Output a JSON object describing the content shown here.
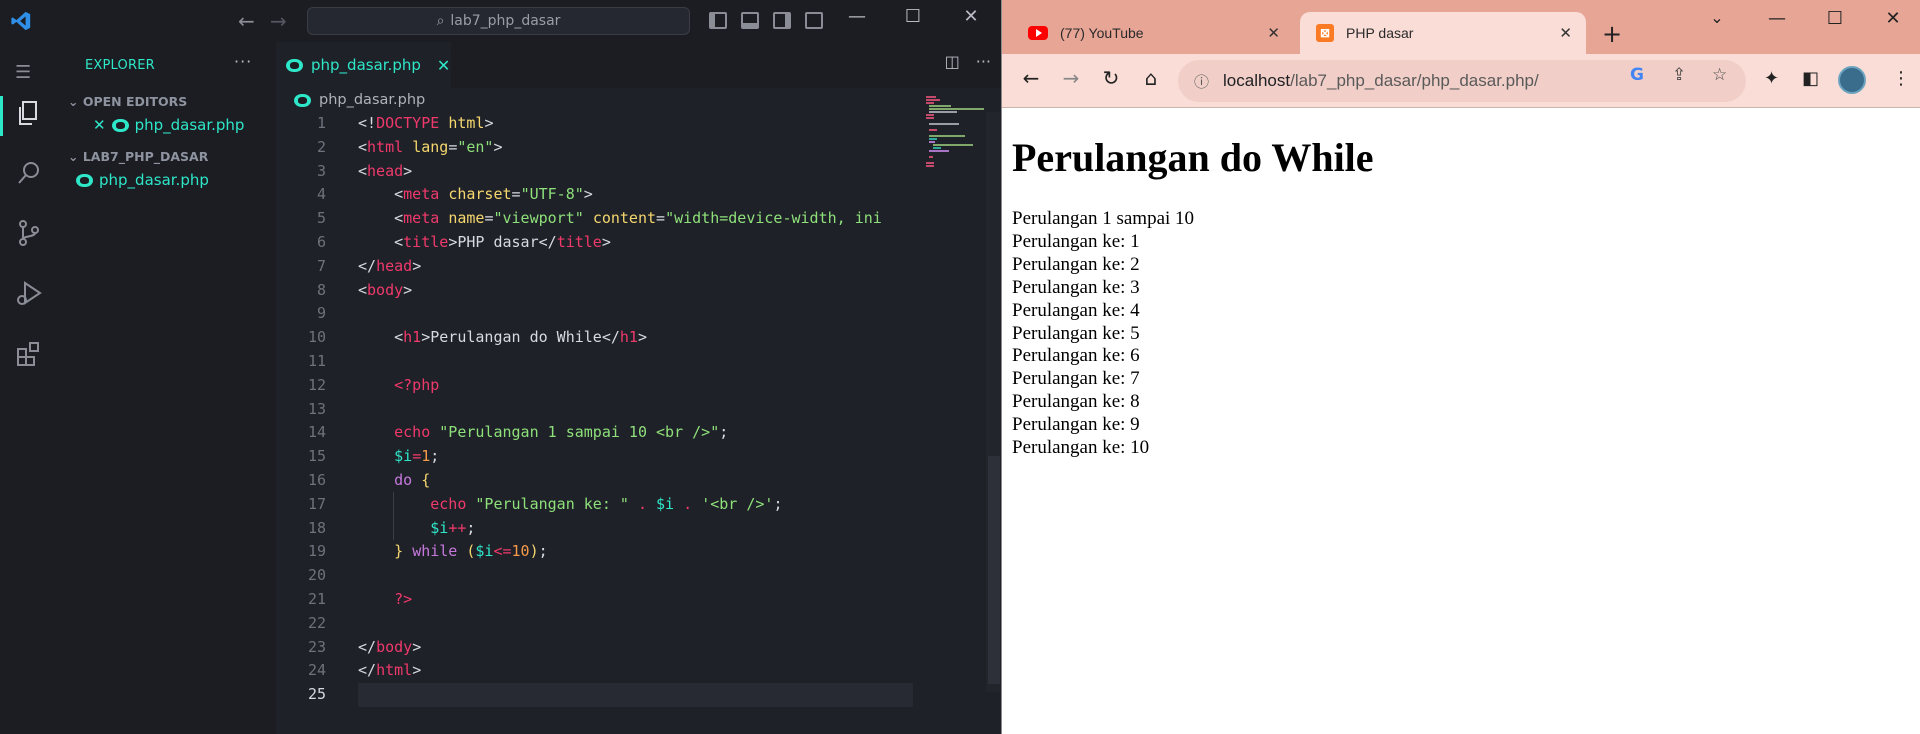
{
  "vscode": {
    "search_text": "lab7_php_dasar",
    "sidebar": {
      "title": "EXPLORER",
      "open_editors_header": "OPEN EDITORS",
      "open_editor_file": "php_dasar.php",
      "project_header": "LAB7_PHP_DASAR",
      "project_file": "php_dasar.php"
    },
    "tab": {
      "label": "php_dasar.php"
    },
    "breadcrumb": "php_dasar.php",
    "code_lines": [
      "1",
      "2",
      "3",
      "4",
      "5",
      "6",
      "7",
      "8",
      "9",
      "10",
      "11",
      "12",
      "13",
      "14",
      "15",
      "16",
      "17",
      "18",
      "19",
      "20",
      "21",
      "22",
      "23",
      "24",
      "25"
    ]
  },
  "chrome": {
    "tabs": [
      {
        "label": "(77) YouTube",
        "icon": "youtube-icon"
      },
      {
        "label": "PHP dasar",
        "icon": "xampp-icon"
      }
    ],
    "url_host": "localhost",
    "url_path": "/lab7_php_dasar/php_dasar.php/",
    "page": {
      "heading": "Perulangan do While",
      "lines": [
        "Perulangan 1 sampai 10",
        "Perulangan ke: 1",
        "Perulangan ke: 2",
        "Perulangan ke: 3",
        "Perulangan ke: 4",
        "Perulangan ke: 5",
        "Perulangan ke: 6",
        "Perulangan ke: 7",
        "Perulangan ke: 8",
        "Perulangan ke: 9",
        "Perulangan ke: 10"
      ]
    }
  },
  "colors": {
    "accent": "#2ee6c8",
    "chrome_tabstrip": "#e7a596",
    "chrome_active": "#f9ddd6"
  }
}
